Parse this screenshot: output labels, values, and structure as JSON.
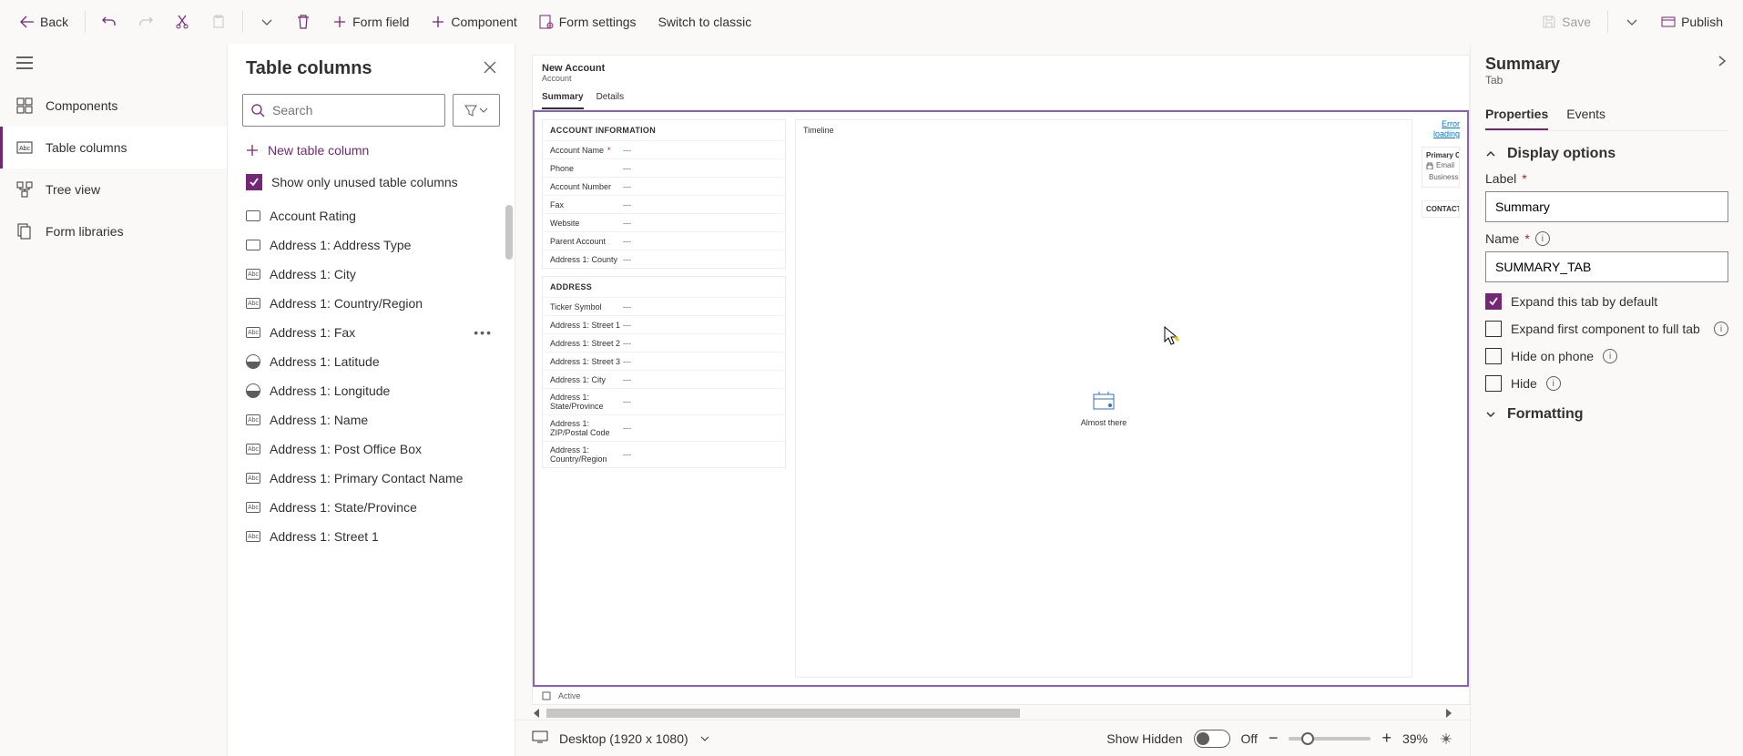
{
  "cmdbar": {
    "back": "Back",
    "form_field": "Form field",
    "component": "Component",
    "form_settings": "Form settings",
    "switch_classic": "Switch to classic",
    "save": "Save",
    "publish": "Publish"
  },
  "nav": {
    "components": "Components",
    "table_columns": "Table columns",
    "tree_view": "Tree view",
    "form_libraries": "Form libraries"
  },
  "panel": {
    "title": "Table columns",
    "search_placeholder": "Search",
    "new_column": "New table column",
    "show_unused": "Show only unused table columns",
    "columns": [
      {
        "label": "Account Rating",
        "icon": "text"
      },
      {
        "label": "Address 1: Address Type",
        "icon": "text"
      },
      {
        "label": "Address 1: City",
        "icon": "abc"
      },
      {
        "label": "Address 1: Country/Region",
        "icon": "abc"
      },
      {
        "label": "Address 1: Fax",
        "icon": "abc",
        "hovered": true
      },
      {
        "label": "Address 1: Latitude",
        "icon": "globe"
      },
      {
        "label": "Address 1: Longitude",
        "icon": "globe"
      },
      {
        "label": "Address 1: Name",
        "icon": "abc"
      },
      {
        "label": "Address 1: Post Office Box",
        "icon": "abc"
      },
      {
        "label": "Address 1: Primary Contact Name",
        "icon": "abc"
      },
      {
        "label": "Address 1: State/Province",
        "icon": "abc"
      },
      {
        "label": "Address 1: Street 1",
        "icon": "abc"
      }
    ]
  },
  "canvas": {
    "form_title": "New Account",
    "form_sub": "Account",
    "tabs": [
      "Summary",
      "Details"
    ],
    "section1_title": "ACCOUNT INFORMATION",
    "section1_fields": [
      {
        "label": "Account Name",
        "req": true,
        "val": "---"
      },
      {
        "label": "Phone",
        "val": "---"
      },
      {
        "label": "Account Number",
        "val": "---"
      },
      {
        "label": "Fax",
        "val": "---"
      },
      {
        "label": "Website",
        "val": "---"
      },
      {
        "label": "Parent Account",
        "val": "---"
      },
      {
        "label": "Address 1: County",
        "val": "---"
      }
    ],
    "section2_title": "ADDRESS",
    "section2_fields": [
      {
        "label": "Ticker Symbol",
        "val": "---"
      },
      {
        "label": "Address 1: Street 1",
        "val": "---"
      },
      {
        "label": "Address 1: Street 2",
        "val": "---"
      },
      {
        "label": "Address 1: Street 3",
        "val": "---"
      },
      {
        "label": "Address 1: City",
        "val": "---"
      },
      {
        "label": "Address 1: State/Province",
        "val": "---"
      },
      {
        "label": "Address 1: ZIP/Postal Code",
        "val": "---"
      },
      {
        "label": "Address 1: Country/Region",
        "val": "---"
      }
    ],
    "timeline_title": "Timeline",
    "timeline_msg": "Almost there",
    "err_link": "Error loading",
    "side_primary": "Primary Co",
    "side_email": "Email",
    "side_business": "Business",
    "side_contacts": "CONTACTS",
    "status": "Active",
    "footer_device": "Desktop (1920 x 1080)",
    "footer_show_hidden": "Show Hidden",
    "footer_toggle": "Off",
    "footer_zoom": "39%"
  },
  "props": {
    "title": "Summary",
    "sub": "Tab",
    "tab_properties": "Properties",
    "tab_events": "Events",
    "group_display": "Display options",
    "label_label": "Label",
    "label_value": "Summary",
    "name_label": "Name",
    "name_value": "SUMMARY_TAB",
    "expand_default": "Expand this tab by default",
    "expand_first": "Expand first component to full tab",
    "hide_phone": "Hide on phone",
    "hide": "Hide",
    "group_formatting": "Formatting"
  }
}
